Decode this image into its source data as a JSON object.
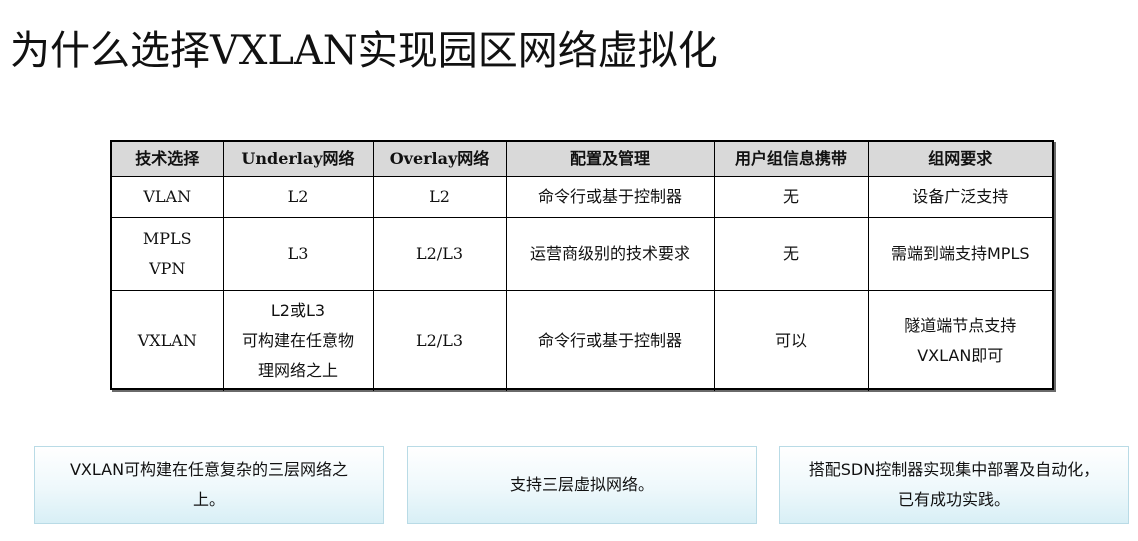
{
  "title": "为什么选择VXLAN实现园区网络虚拟化",
  "table": {
    "headers": [
      "技术选择",
      "Underlay网络",
      "Overlay网络",
      "配置及管理",
      "用户组信息携带",
      "组网要求"
    ],
    "rows": [
      {
        "tech": [
          "VLAN"
        ],
        "underlay": [
          "L2"
        ],
        "overlay": [
          "L2"
        ],
        "config": [
          "命令行或基于控制器"
        ],
        "usergroup": [
          "无"
        ],
        "requirement": [
          "设备广泛支持"
        ]
      },
      {
        "tech": [
          "MPLS",
          "VPN"
        ],
        "underlay": [
          "L3"
        ],
        "overlay": [
          "L2/L3"
        ],
        "config": [
          "运营商级别的技术要求"
        ],
        "usergroup": [
          "无"
        ],
        "requirement": [
          "需端到端支持MPLS"
        ]
      },
      {
        "tech": [
          "VXLAN"
        ],
        "underlay": [
          "L2或L3",
          "可构建在任意物",
          "理网络之上"
        ],
        "overlay": [
          "L2/L3"
        ],
        "config": [
          "命令行或基于控制器"
        ],
        "usergroup": [
          "可以"
        ],
        "requirement": [
          "隧道端节点支持",
          "VXLAN即可"
        ]
      }
    ]
  },
  "boxes": [
    {
      "lines": [
        "VXLAN可构建在任意复杂的三层网络之",
        "上。"
      ]
    },
    {
      "lines": [
        "支持三层虚拟网络。"
      ]
    },
    {
      "lines": [
        "搭配SDN控制器实现集中部署及自动化，",
        "已有成功实践。"
      ]
    }
  ],
  "colors": {
    "header_bg": "#d9d9d9",
    "box_border": "#b9dbe6",
    "box_gradient_end": "#d8eff6"
  }
}
